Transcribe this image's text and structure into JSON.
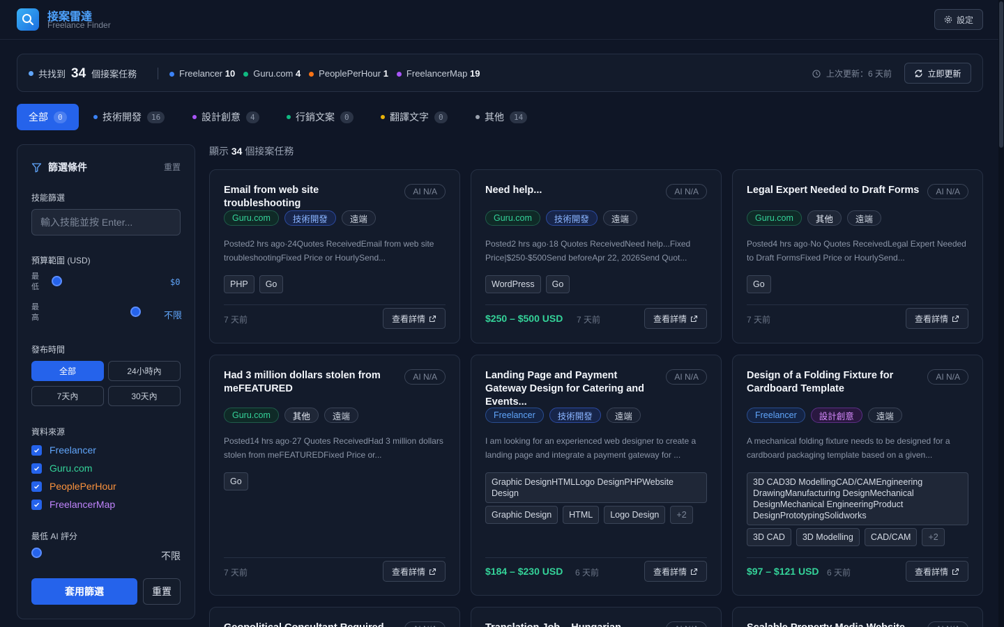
{
  "app": {
    "title": "接案雷達",
    "subtitle": "Freelance Finder",
    "settings_label": "設定"
  },
  "summary": {
    "prefix": "共找到",
    "total": "34",
    "suffix": "個接案任務",
    "sources": [
      {
        "name": "Freelancer",
        "count": "10",
        "color": "#3b82f6"
      },
      {
        "name": "Guru.com",
        "count": "4",
        "color": "#10b981"
      },
      {
        "name": "PeoplePerHour",
        "count": "1",
        "color": "#f97316"
      },
      {
        "name": "FreelancerMap",
        "count": "19",
        "color": "#a855f7"
      }
    ],
    "last_update": "上次更新：6 天前",
    "refresh_label": "立即更新"
  },
  "tabs": [
    {
      "label": "全部",
      "count": "0",
      "color": ""
    },
    {
      "label": "技術開發",
      "count": "16",
      "color": "#3b82f6"
    },
    {
      "label": "設計創意",
      "count": "4",
      "color": "#a855f7"
    },
    {
      "label": "行銷文案",
      "count": "0",
      "color": "#10b981"
    },
    {
      "label": "翻譯文字",
      "count": "0",
      "color": "#eab308"
    },
    {
      "label": "其他",
      "count": "14",
      "color": "#9ca3af"
    }
  ],
  "filters": {
    "title": "篩選條件",
    "reset_link": "重置",
    "skill_label": "技能篩選",
    "skill_placeholder": "輸入技能並按 Enter...",
    "budget_label": "預算範圍 (USD)",
    "min_label": "最低",
    "min_value": "$0",
    "max_label": "最高",
    "max_value": "不限",
    "time_label": "發布時間",
    "time_options": [
      "全部",
      "24小時內",
      "7天內",
      "30天內"
    ],
    "source_label": "資料來源",
    "sources": [
      {
        "name": "Freelancer",
        "color": "#60a5fa",
        "checked": true
      },
      {
        "name": "Guru.com",
        "color": "#34d399",
        "checked": true
      },
      {
        "name": "PeoplePerHour",
        "color": "#fb923c",
        "checked": true
      },
      {
        "name": "FreelancerMap",
        "color": "#c084fc",
        "checked": true
      }
    ],
    "ai_label": "最低 AI 評分",
    "ai_value": "不限",
    "apply_label": "套用篩選",
    "reset_label": "重置"
  },
  "results": {
    "prefix": "顯示",
    "count": "34",
    "suffix": "個接案任務"
  },
  "card_labels": {
    "detail": "查看詳情",
    "ai": "AI N/A"
  },
  "jobs": [
    {
      "title": "Email from web site troubleshooting",
      "source": "Guru.com",
      "category": "技術開發",
      "remote": "遠端",
      "desc": "Posted2 hrs ago·24Quotes ReceivedEmail from web site troubleshootingFixed Price or HourlySend...",
      "skills": [
        "PHP",
        "Go"
      ],
      "price": "",
      "ago": "7 天前"
    },
    {
      "title": "Need help...",
      "source": "Guru.com",
      "category": "技術開發",
      "remote": "遠端",
      "desc": "Posted2 hrs ago·18 Quotes ReceivedNeed help...Fixed Price|$250-$500Send beforeApr 22, 2026Send Quot...",
      "skills": [
        "WordPress",
        "Go"
      ],
      "price": "$250 – $500 USD",
      "ago": "7 天前"
    },
    {
      "title": "Legal Expert Needed to Draft Forms",
      "source": "Guru.com",
      "category": "其他",
      "remote": "遠端",
      "desc": "Posted4 hrs ago·No Quotes ReceivedLegal Expert Needed to Draft FormsFixed Price or HourlySend...",
      "skills": [
        "Go"
      ],
      "price": "",
      "ago": "7 天前"
    },
    {
      "title": "Had 3 million dollars stolen from meFEATURED",
      "source": "Guru.com",
      "category": "其他",
      "remote": "遠端",
      "desc": "Posted14 hrs ago·27 Quotes ReceivedHad 3 million dollars stolen from meFEATUREDFixed Price or...",
      "skills": [
        "Go"
      ],
      "price": "",
      "ago": "7 天前"
    },
    {
      "title": "Landing Page and Payment Gateway Design for Catering and Events...",
      "source": "Freelancer",
      "category": "技術開發",
      "remote": "遠端",
      "desc": "I am looking for an experienced web designer to create a landing page and integrate a payment gateway for ...",
      "skill_box": "Graphic DesignHTMLLogo DesignPHPWebsite Design",
      "skills": [
        "Graphic Design",
        "HTML",
        "Logo Design"
      ],
      "more": "+2",
      "price": "$184 – $230 USD",
      "ago": "6 天前"
    },
    {
      "title": "Design of a Folding Fixture for Cardboard Template",
      "source": "Freelancer",
      "category": "設計創意",
      "remote": "遠端",
      "desc": "A mechanical folding fixture needs to be designed for a cardboard packaging template based on a given...",
      "skill_box": "3D CAD3D ModellingCAD/CAMEngineering DrawingManufacturing DesignMechanical DesignMechanical EngineeringProduct DesignPrototypingSolidworks",
      "skills": [
        "3D CAD",
        "3D Modelling",
        "CAD/CAM"
      ],
      "more": "+2",
      "price": "$97 – $121 USD",
      "ago": "6 天前"
    },
    {
      "title": "Geopolitical Consultant Required",
      "source": "",
      "category": "",
      "remote": "",
      "desc": "",
      "skills": [],
      "price": "",
      "ago": ""
    },
    {
      "title": "Translation Job – Hungarian",
      "source": "",
      "category": "",
      "remote": "",
      "desc": "",
      "skills": [],
      "price": "",
      "ago": ""
    },
    {
      "title": "Scalable Property Media Website",
      "source": "",
      "category": "",
      "remote": "",
      "desc": "",
      "skills": [],
      "price": "",
      "ago": ""
    }
  ]
}
